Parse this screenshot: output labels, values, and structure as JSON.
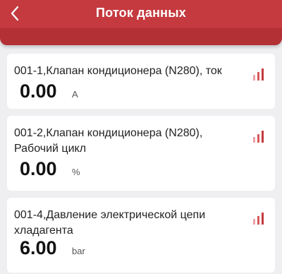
{
  "header": {
    "title": "Поток данных",
    "back_icon": "chevron-left-icon",
    "color": "#c43a3e"
  },
  "items": [
    {
      "name": "001-1,Клапан кондиционера (N280), ток",
      "value": "0.00",
      "unit": "A",
      "chart_icon": "bar-chart-icon"
    },
    {
      "name": "001-2,Клапан кондиционера (N280), Рабочий цикл",
      "value": "0.00",
      "unit": "%",
      "chart_icon": "bar-chart-icon"
    },
    {
      "name": "001-4,Давление электрической цепи хладагента",
      "value": "6.00",
      "unit": "bar",
      "chart_icon": "bar-chart-icon"
    }
  ]
}
